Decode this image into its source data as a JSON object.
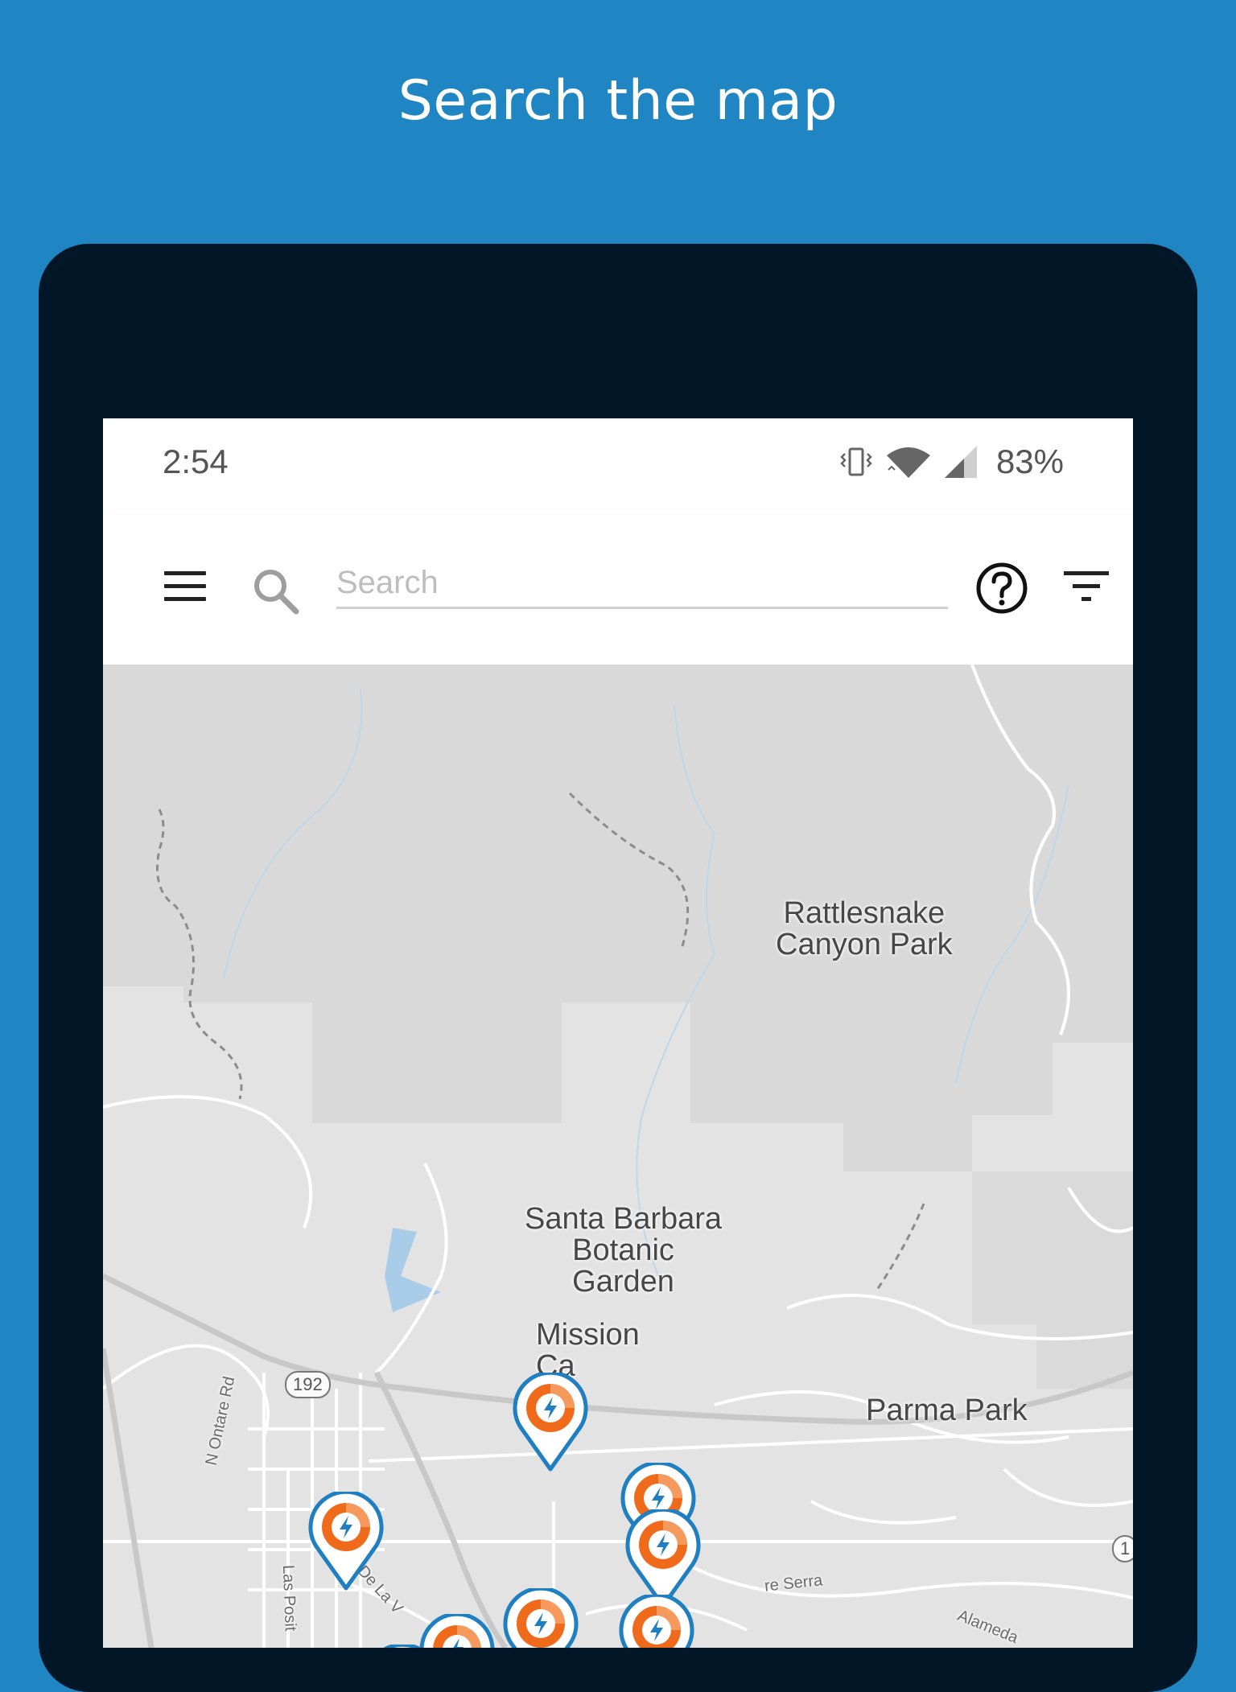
{
  "banner": {
    "title": "Search the map"
  },
  "status_bar": {
    "time": "2:54",
    "battery": "83%"
  },
  "toolbar": {
    "search_placeholder": "Search",
    "menu_icon": "hamburger-menu-icon",
    "search_icon": "search-icon",
    "help_icon": "help-circle-icon",
    "filter_icon": "filter-icon"
  },
  "map": {
    "labels": {
      "rattlesnake_1": "Rattlesnake",
      "rattlesnake_2": "Canyon Park",
      "botanic_1": "Santa Barbara",
      "botanic_2": "Botanic",
      "botanic_3": "Garden",
      "mission_1": "Mission",
      "mission_2": "Ca",
      "parma": "Parma Park",
      "ontare": "N Ontare Rd",
      "lasposit": "Las Posit",
      "delav": "De La V",
      "serra": "re Serra",
      "alameda": "Alameda",
      "hwy192": "192",
      "hwy_edge": "1"
    },
    "pins": [
      "ev-charger-pin",
      "ev-charger-pin",
      "ev-charger-pin",
      "ev-charger-pin",
      "ev-charger-pin",
      "ev-charger-pin",
      "ev-charger-pin",
      "ev-charger-pin",
      "ev-charger-pin",
      "ev-charger-pin",
      "ev-charger-pin",
      "ev-charger-pin"
    ]
  },
  "colors": {
    "background": "#1f86c3",
    "device_frame": "#011728",
    "pin_outline": "#1f7fc0",
    "pin_fill": "#f06a1b",
    "map_land": "#e3e3e3",
    "map_park": "#d9d9d9"
  }
}
